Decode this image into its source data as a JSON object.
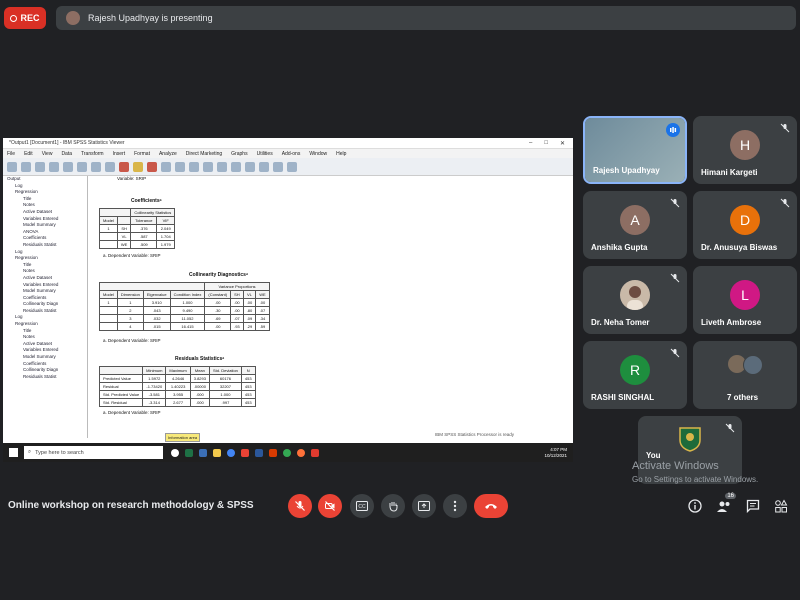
{
  "top": {
    "rec_label": "REC",
    "presenting_text": "Rajesh Upadhyay is presenting"
  },
  "shared_window": {
    "title": "*Output1 [Document1] - IBM SPSS Statistics Viewer",
    "menu": [
      "File",
      "Edit",
      "View",
      "Data",
      "Transform",
      "Insert",
      "Format",
      "Analyze",
      "Direct Marketing",
      "Graphs",
      "Utilities",
      "Add-ons",
      "Window",
      "Help"
    ],
    "tree": [
      "Output",
      "Log",
      "Regression",
      "Title",
      "Notes",
      "Active Dataset",
      "Variables Entered",
      "Model Summary",
      "ANOVA",
      "Coefficients",
      "Residuals Statist",
      "Log",
      "Regression",
      "Title",
      "Notes",
      "Active Dataset",
      "Variables Entered",
      "Model Summary",
      "Coefficients",
      "Collinearity Diagn",
      "Residuals Statist",
      "Log",
      "Regression",
      "Title",
      "Notes",
      "Active Dataset",
      "Variables Entered",
      "Model Summary",
      "Coefficients",
      "Collinearity Diagn",
      "Residuals Statist"
    ],
    "dependent_top": "Variable: SRIP",
    "coefficients": {
      "title": "Coefficientsᵃ",
      "header_group": "Collinearity Statistics",
      "headers": [
        "Model",
        "",
        "Tolerance",
        "VIF"
      ],
      "rows": [
        [
          "1",
          "SH",
          ".376",
          "2.049"
        ],
        [
          "",
          "VL",
          ".587",
          "1.704"
        ],
        [
          "",
          "WE",
          ".509",
          "1.979"
        ]
      ],
      "note": "a. Dependent Variable: SRIP"
    },
    "collinearity": {
      "title": "Collinearity Diagnosticsᵃ",
      "group": "Variance Proportions",
      "headers": [
        "Model",
        "Dimension",
        "Eigenvalue",
        "Condition Index",
        "(Constant)",
        "SH",
        "VL",
        "WE"
      ],
      "rows": [
        [
          "1",
          "1",
          "3.910",
          "1.000",
          ".00",
          ".00",
          ".00",
          ".00"
        ],
        [
          "",
          "2",
          ".043",
          "9.490",
          ".30",
          ".00",
          ".80",
          ".07"
        ],
        [
          "",
          "3",
          ".032",
          "11.052",
          ".69",
          ".07",
          ".09",
          ".34"
        ],
        [
          "",
          "4",
          ".015",
          "16.415",
          ".00",
          ".93",
          ".29",
          ".59"
        ]
      ],
      "note": "a. Dependent Variable: SRIP"
    },
    "residuals": {
      "title": "Residuals Statisticsᵃ",
      "headers": [
        "",
        "Minimum",
        "Maximum",
        "Mean",
        "Std. Deviation",
        "N"
      ],
      "rows": [
        [
          "Predicted Value",
          "1.5972",
          "4.2646",
          "3.8293",
          "60176",
          "453"
        ],
        [
          "Residual",
          "-1.73420",
          "1.40223",
          ".00000",
          "32207",
          "453"
        ],
        [
          "Std. Predicted Value",
          "-3.581",
          "3.955",
          ".000",
          "1.000",
          "453"
        ],
        [
          "Std. Residual",
          "-3.314",
          "2.677",
          ".000",
          ".997",
          "453"
        ]
      ],
      "note": "a. Dependent Variable: SRIP"
    },
    "tooltip": "Information area",
    "status": "IBM SPSS Statistics Processor is ready",
    "taskbar_search": "Type here to search",
    "clock_time": "4:07 PM",
    "clock_date": "10/12/2021"
  },
  "participants": [
    {
      "name": "Rajesh Upadhyay",
      "initial": "",
      "color": "#8ab4f8",
      "speaking": true
    },
    {
      "name": "Himani Kargeti",
      "initial": "H",
      "color": "#8d6e63"
    },
    {
      "name": "Anshika Gupta",
      "initial": "A",
      "color": "#8d6e63"
    },
    {
      "name": "Dr. Anusuya Biswas",
      "initial": "D",
      "color": "#e8710a"
    },
    {
      "name": "Dr. Neha Tomer",
      "initial": "",
      "color": "#5f6368"
    },
    {
      "name": "Liveth Ambrose",
      "initial": "L",
      "color": "#d01884"
    },
    {
      "name": "RASHI SINGHAL",
      "initial": "R",
      "color": "#1e8e3e"
    },
    {
      "name": "7 others",
      "initial": "",
      "color": "#5f6368"
    },
    {
      "name": "You",
      "initial": "",
      "color": "#1e6b3a"
    }
  ],
  "watermark": {
    "line1": "Activate Windows",
    "line2": "Go to Settings to activate Windows."
  },
  "bottom": {
    "meeting_title": "Online workshop on research methodology & SPSS",
    "participant_count": "16"
  }
}
